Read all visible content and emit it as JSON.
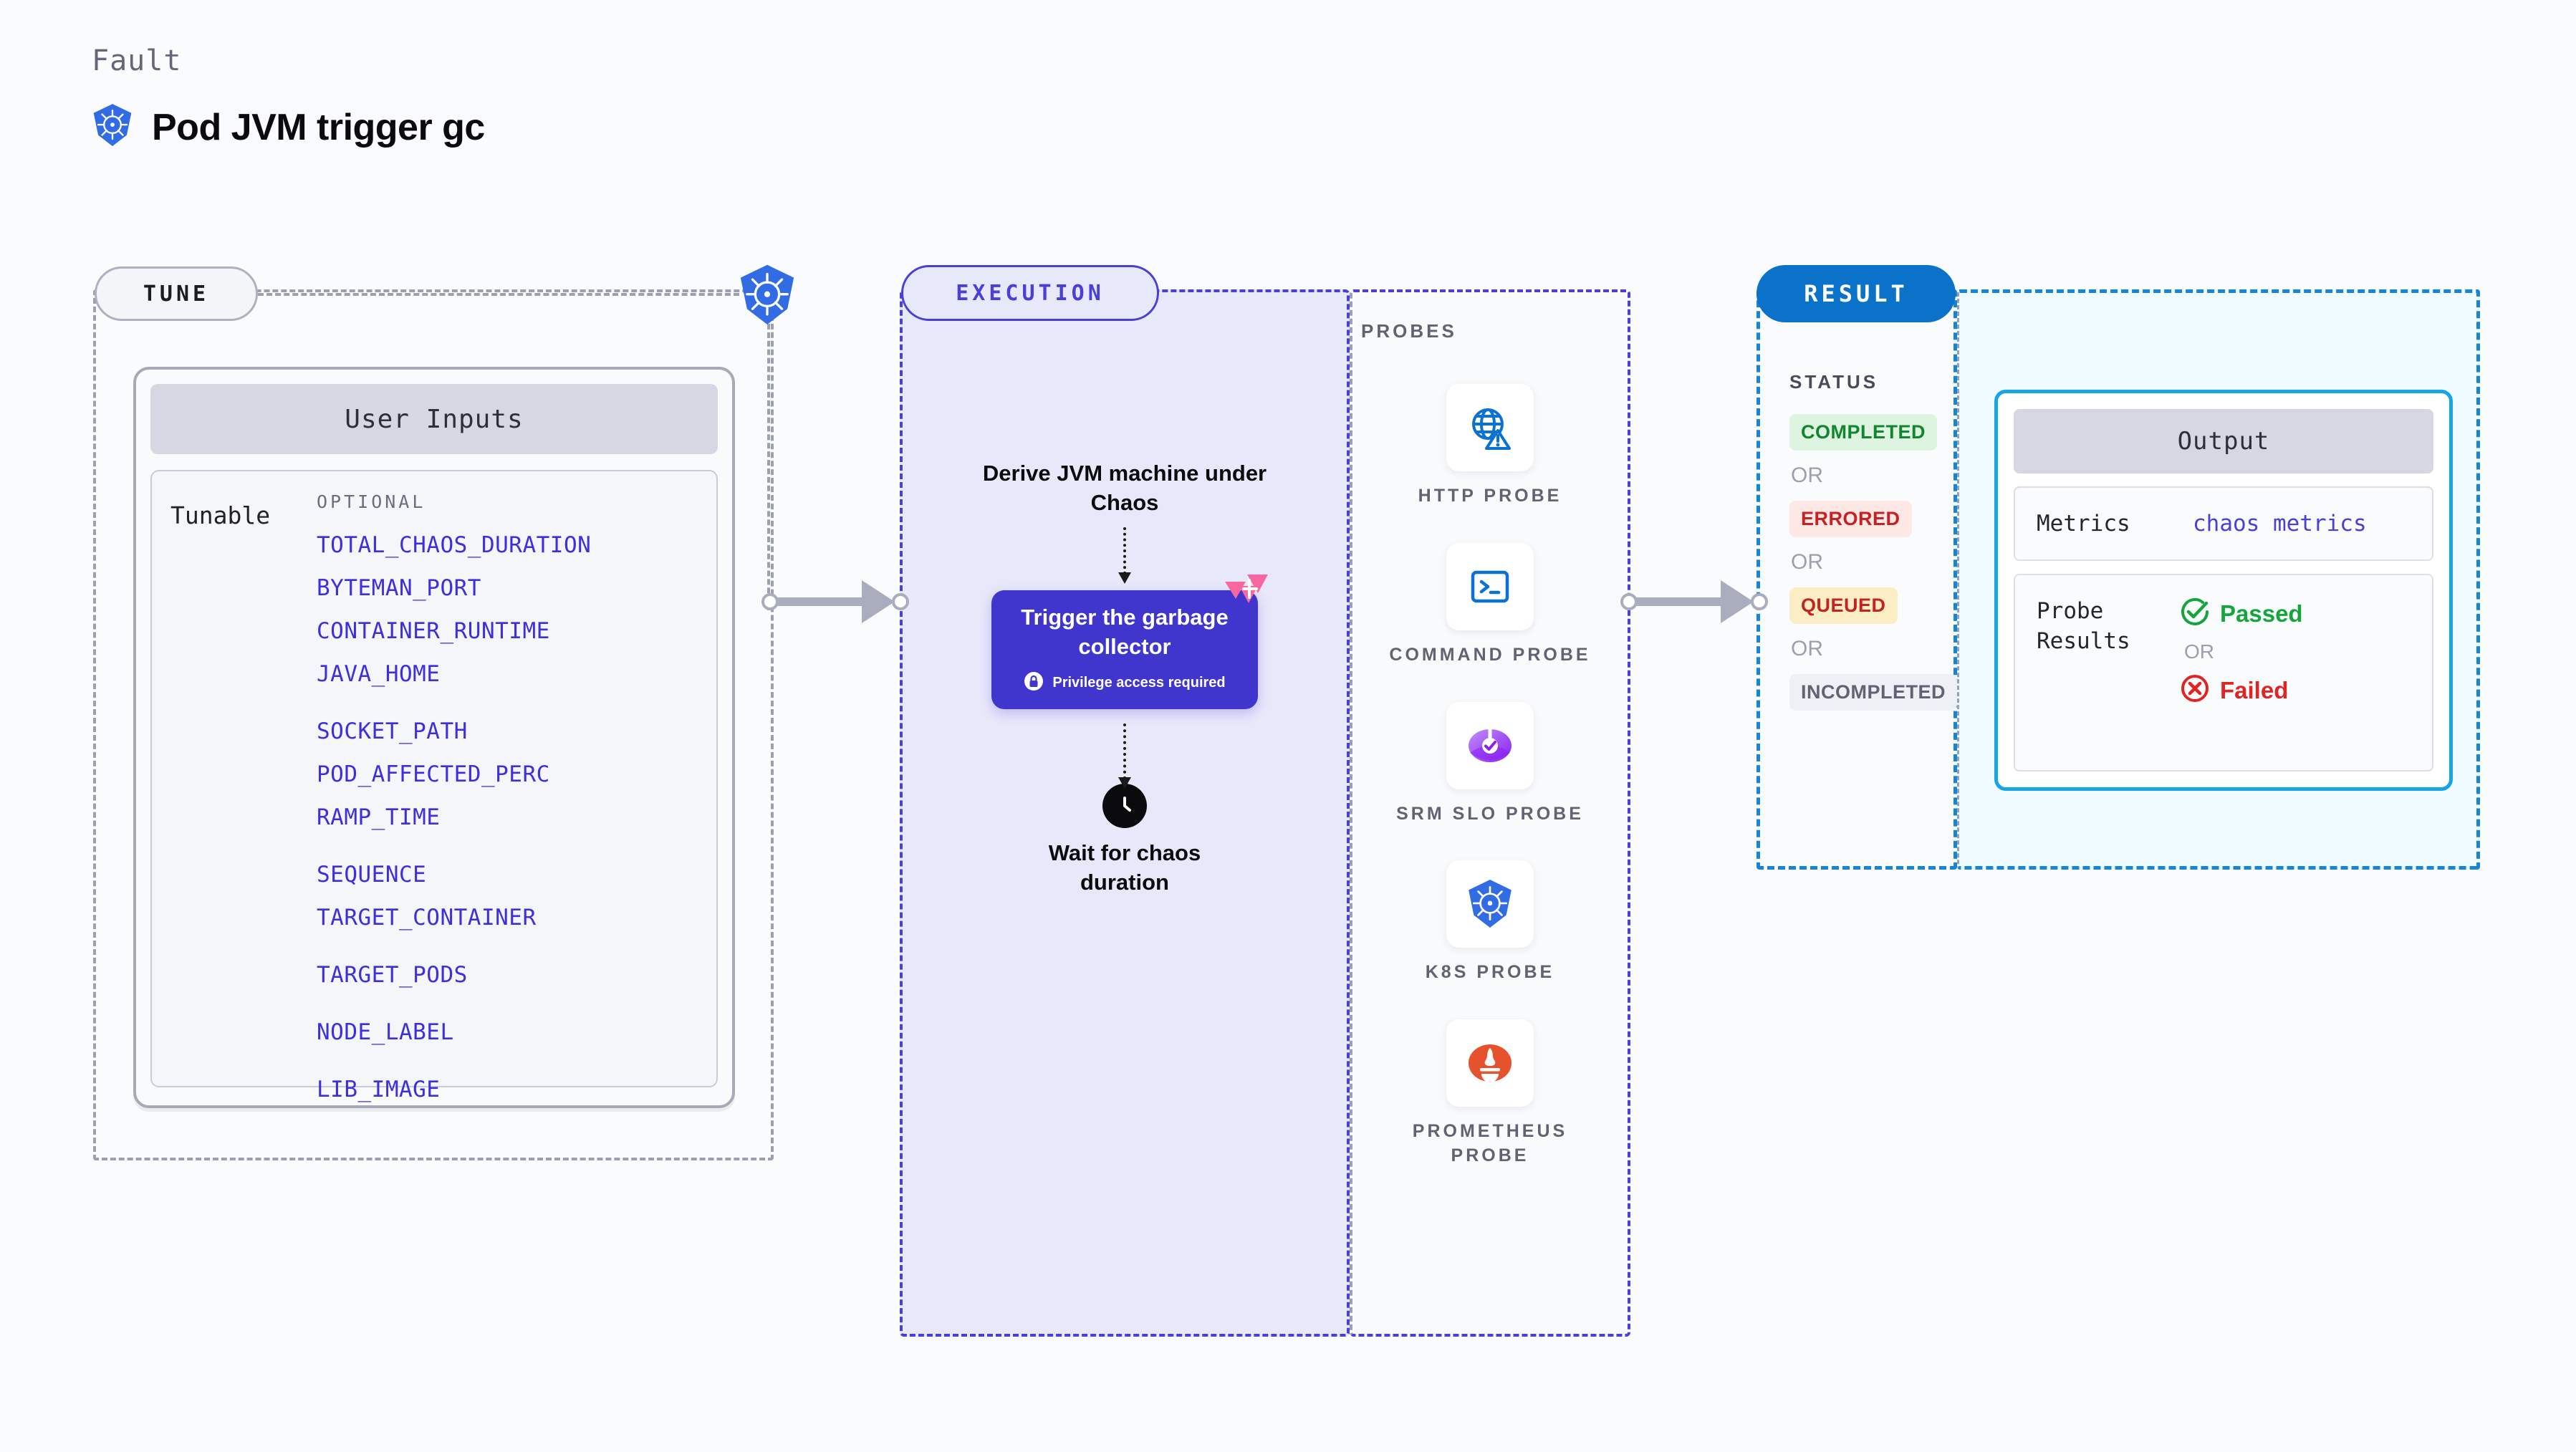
{
  "header": {
    "eyebrow": "Fault",
    "title": "Pod JVM trigger gc",
    "icon": "kubernetes-icon"
  },
  "tune": {
    "pill_label": "TUNE",
    "card_title": "User Inputs",
    "tunable_label": "Tunable",
    "optional_label": "OPTIONAL",
    "tunables": [
      "TOTAL_CHAOS_DURATION",
      "BYTEMAN_PORT",
      "CONTAINER_RUNTIME",
      "JAVA_HOME",
      "SOCKET_PATH",
      "POD_AFFECTED_PERC",
      "RAMP_TIME",
      "SEQUENCE",
      "TARGET_CONTAINER",
      "TARGET_PODS",
      "NODE_LABEL",
      "LIB_IMAGE"
    ]
  },
  "execution": {
    "pill_label": "EXECUTION",
    "derive_step": "Derive JVM machine under Chaos",
    "action_node": {
      "title": "Trigger the garbage collector",
      "privilege_note": "Privilege access required",
      "lock_icon": "lock-icon",
      "badge_icon": "chaos-flag-badge-icon"
    },
    "wait_step": {
      "label": "Wait for chaos duration",
      "icon": "clock-icon"
    }
  },
  "probes": {
    "section_label": "PROBES",
    "items": [
      {
        "label": "HTTP PROBE",
        "icon": "globe-alert-icon"
      },
      {
        "label": "COMMAND PROBE",
        "icon": "terminal-icon"
      },
      {
        "label": "SRM SLO PROBE",
        "icon": "srm-slo-gauge-icon"
      },
      {
        "label": "K8S PROBE",
        "icon": "kubernetes-icon"
      },
      {
        "label": "PROMETHEUS PROBE",
        "icon": "prometheus-icon"
      }
    ]
  },
  "result": {
    "pill_label": "RESULT",
    "status_label": "STATUS",
    "or_label": "OR",
    "statuses": [
      {
        "label": "COMPLETED",
        "color": "#11862f",
        "bg": "#ddf5e0"
      },
      {
        "label": "ERRORED",
        "color": "#c62222",
        "bg": "#fde8e6"
      },
      {
        "label": "QUEUED",
        "color": "#c62222",
        "bg": "#fbeec4"
      },
      {
        "label": "INCOMPLETED",
        "color": "#5f6374",
        "bg": "#eef0f5"
      }
    ],
    "output": {
      "card_title": "Output",
      "metrics_key": "Metrics",
      "metrics_value": "chaos metrics",
      "probe_results_key": "Probe Results",
      "passed_label": "Passed",
      "failed_label": "Failed",
      "passed_icon": "check-circle-icon",
      "failed_icon": "x-circle-icon",
      "or_label": "OR"
    }
  },
  "colors": {
    "accent_blue": "#0a72c8",
    "accent_violet": "#4a3fd6",
    "node_violet": "#4035cc",
    "kubernetes_blue": "#326ce5",
    "badge_pink": "#f8679e",
    "passed_green": "#14a63c",
    "failed_red": "#e02424",
    "cyan_border": "#18a5e6",
    "tunable_link": "#3d2fe0"
  }
}
